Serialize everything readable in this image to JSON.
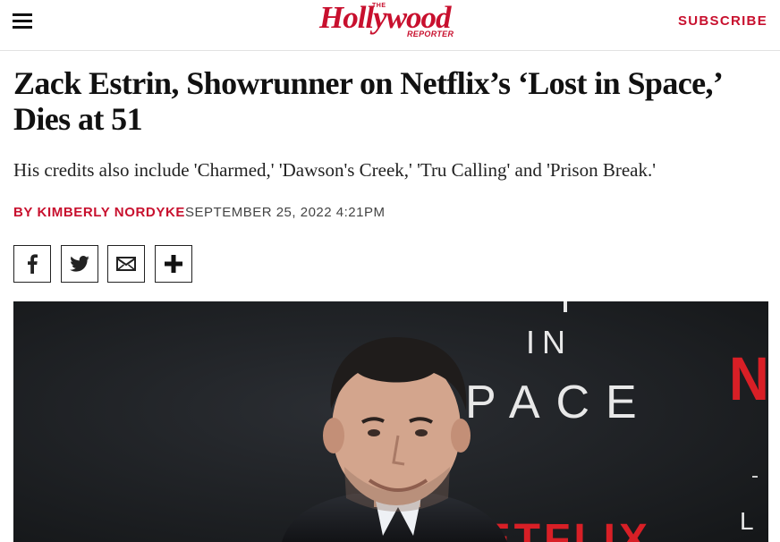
{
  "header": {
    "logo": {
      "the": "THE",
      "main": "Hollywood",
      "sub": "REPORTER"
    },
    "subscribe_label": "SUBSCRIBE",
    "brand_color": "#c8102e",
    "menu_icon": "hamburger-icon"
  },
  "article": {
    "headline": "Zack Estrin, Showrunner on Netflix’s ‘Lost in Space,’ Dies at 51",
    "dek": "His credits also include 'Charmed,' 'Dawson's Creek,' 'Tru Calling' and 'Prison Break.'",
    "byline_prefix": "BY ",
    "author": "KIMBERLY NORDYKE",
    "date": "SEPTEMBER 25, 2022 4:21PM"
  },
  "share": {
    "icons": [
      "facebook-icon",
      "twitter-icon",
      "email-icon",
      "plus-icon"
    ]
  },
  "hero_image": {
    "backdrop_text": [
      "IN",
      "PACE"
    ],
    "brand_text": [
      "NE",
      "NETFLIX"
    ],
    "side_marks": [
      "L"
    ]
  }
}
